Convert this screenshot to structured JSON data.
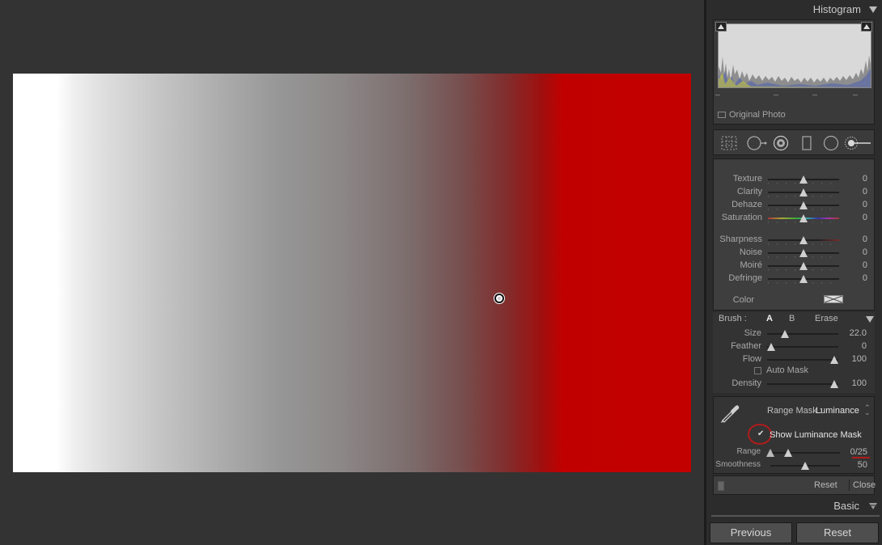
{
  "histogram": {
    "title": "Histogram",
    "original_photo_label": "Original Photo"
  },
  "tools": [
    "grid-overlay-icon",
    "crop-icon",
    "spot-removal-icon",
    "graduated-filter-icon",
    "radial-filter-icon",
    "adjustment-brush-icon"
  ],
  "adjustments": {
    "rows_group1": [
      {
        "label": "Texture",
        "value": "0"
      },
      {
        "label": "Clarity",
        "value": "0"
      },
      {
        "label": "Dehaze",
        "value": "0"
      },
      {
        "label": "Saturation",
        "value": "0"
      }
    ],
    "rows_group2": [
      {
        "label": "Sharpness",
        "value": "0"
      },
      {
        "label": "Noise",
        "value": "0"
      },
      {
        "label": "Moiré",
        "value": "0"
      },
      {
        "label": "Defringe",
        "value": "0"
      }
    ],
    "color_label": "Color"
  },
  "brush": {
    "label": "Brush :",
    "a": "A",
    "b": "B",
    "erase": "Erase",
    "size_label": "Size",
    "size_value": "22.0",
    "feather_label": "Feather",
    "feather_value": "0",
    "flow_label": "Flow",
    "flow_value": "100",
    "automask_label": "Auto Mask",
    "density_label": "Density",
    "density_value": "100"
  },
  "range_mask": {
    "label": "Range Mask :",
    "value": "Luminance",
    "show_label": "Show Luminance Mask",
    "range_label": "Range",
    "range_value": "0/25",
    "smoothness_label": "Smoothness",
    "smoothness_value": "50",
    "reset": "Reset",
    "close": "Close"
  },
  "basic_title": "Basic",
  "buttons": {
    "previous": "Previous",
    "reset": "Reset"
  },
  "colors": {
    "accent_red": "#b01b1b",
    "photo_red": "#c30000"
  }
}
